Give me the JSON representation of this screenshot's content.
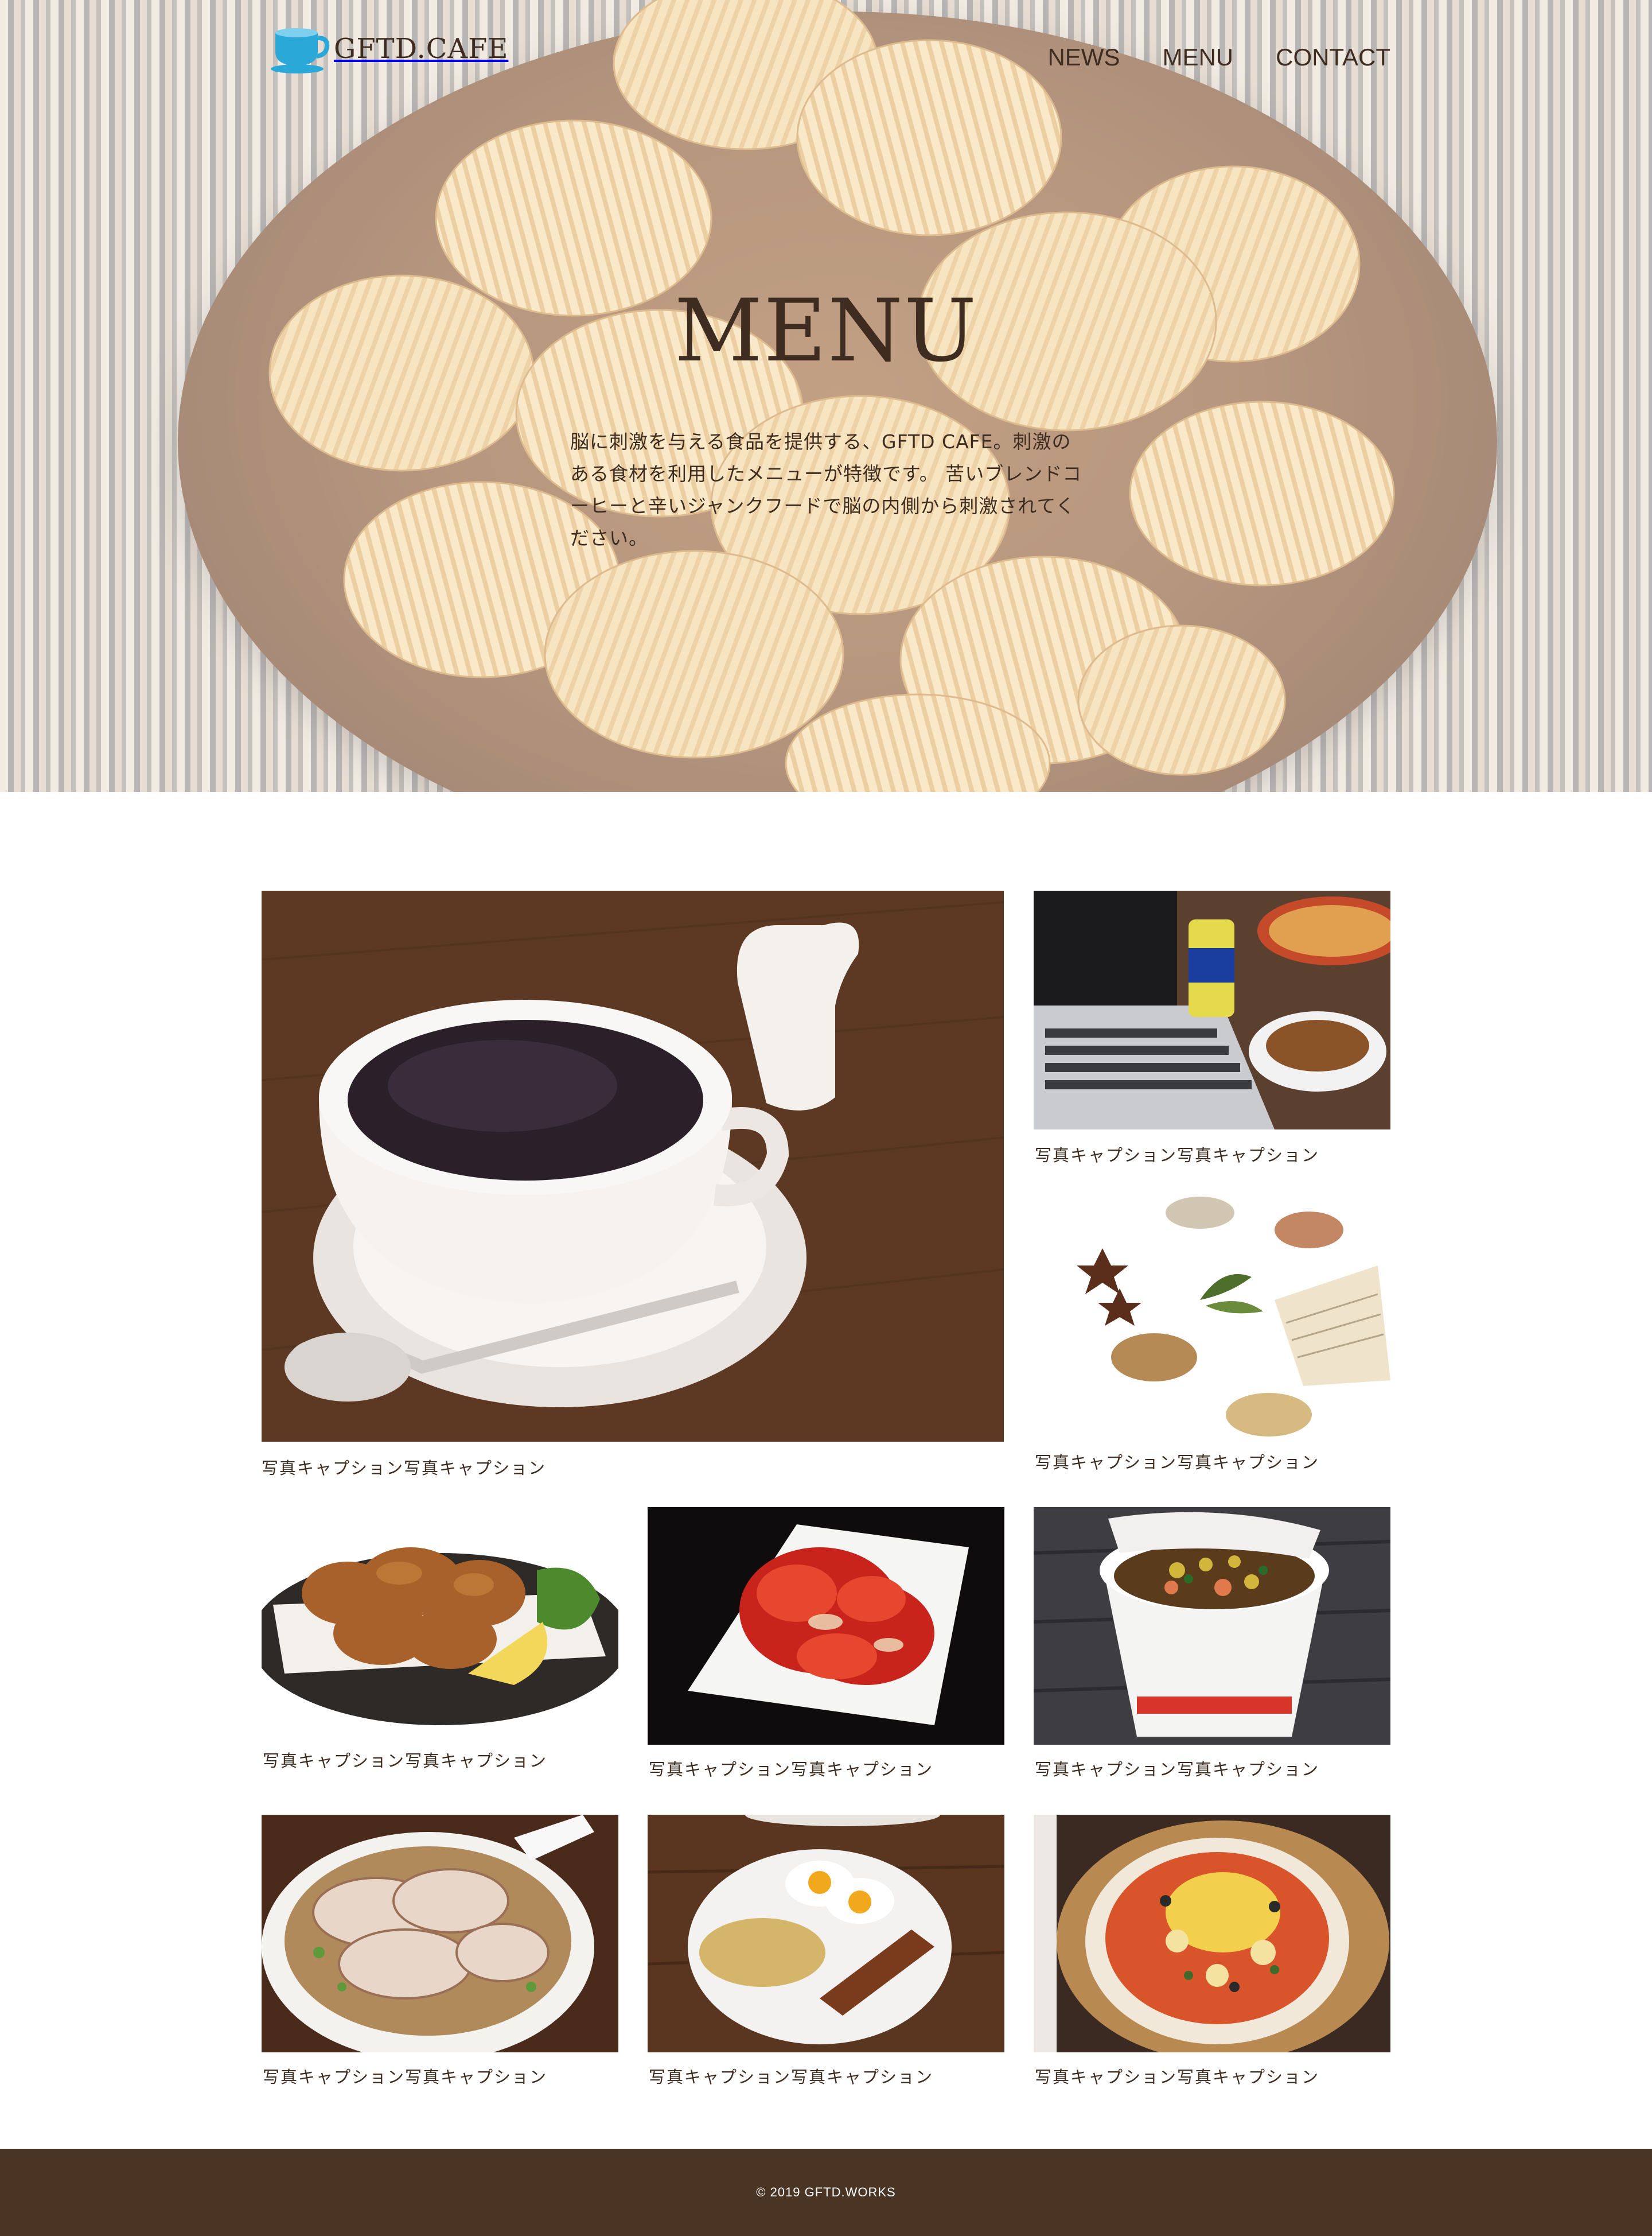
{
  "header": {
    "logo_text": "GFTD.CAFE",
    "logo_icon": "coffee-cup-icon",
    "nav": [
      {
        "label": "NEWS"
      },
      {
        "label": "MENU"
      },
      {
        "label": "CONTACT"
      }
    ]
  },
  "hero": {
    "title": "MENU",
    "description": "脳に刺激を与える食品を提供する、GFTD CAFE。刺激のある食材を利用したメニューが特徴です。 苦いブレンドコーヒーと辛いジャンクフードで脳の内側から刺激されてください。"
  },
  "gallery": [
    {
      "caption": "写真キャプション写真キャプション",
      "image": "coffee-cup-photo"
    },
    {
      "caption": "写真キャプション写真キャプション",
      "image": "laptop-snacks-photo"
    },
    {
      "caption": "写真キャプション写真キャプション",
      "image": "spices-photo"
    },
    {
      "caption": "写真キャプション写真キャプション",
      "image": "fried-chicken-photo"
    },
    {
      "caption": "写真キャプション写真キャプション",
      "image": "kimchi-photo"
    },
    {
      "caption": "写真キャプション写真キャプション",
      "image": "cup-noodle-photo"
    },
    {
      "caption": "写真キャプション写真キャプション",
      "image": "ramen-photo"
    },
    {
      "caption": "写真キャプション写真キャプション",
      "image": "eggs-breakfast-photo"
    },
    {
      "caption": "写真キャプション写真キャプション",
      "image": "pizza-photo"
    }
  ],
  "footer": {
    "copyright": "© 2019 GFTD.WORKS"
  },
  "colors": {
    "text": "#3d2c1f",
    "footer_bg": "#4a3525",
    "logo_accent": "#2aa9d8"
  }
}
